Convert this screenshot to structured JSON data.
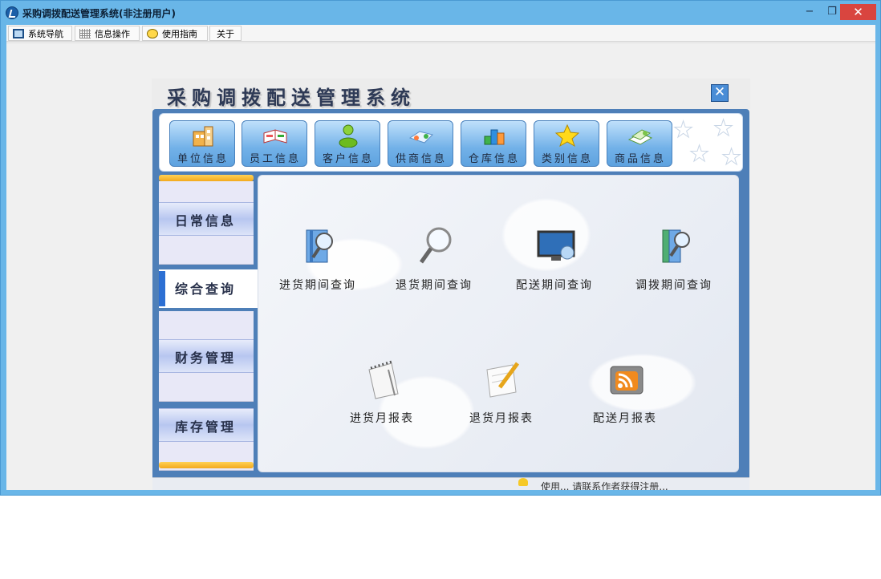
{
  "window": {
    "title": "采购调拨配送管理系统(非注册用户)",
    "controls": [
      "−",
      "❐",
      "✕"
    ]
  },
  "menu": [
    {
      "label": "系统导航",
      "icon": "monitor-icon"
    },
    {
      "label": "信息操作",
      "icon": "grid-icon"
    },
    {
      "label": "使用指南",
      "icon": "smiley-icon"
    },
    {
      "label": "关于",
      "icon": ""
    }
  ],
  "panel": {
    "title": "采购调拨配送管理系统",
    "close_label": "✕"
  },
  "toolbar": [
    {
      "label": "单位信息",
      "icon": "building-icon"
    },
    {
      "label": "员工信息",
      "icon": "book-icon"
    },
    {
      "label": "客户信息",
      "icon": "person-icon"
    },
    {
      "label": "供商信息",
      "icon": "handshake-icon"
    },
    {
      "label": "仓库信息",
      "icon": "warehouse-icon"
    },
    {
      "label": "类别信息",
      "icon": "star-icon"
    },
    {
      "label": "商品信息",
      "icon": "goods-icon"
    }
  ],
  "sidebar": [
    {
      "label": "日常信息",
      "active": false
    },
    {
      "label": "综合查询",
      "active": true
    },
    {
      "label": "财务管理",
      "active": false
    },
    {
      "label": "库存管理",
      "active": false
    }
  ],
  "content": {
    "items": [
      {
        "label": "进货期间查询",
        "icon": "book-search-icon"
      },
      {
        "label": "退货期间查询",
        "icon": "magnifier-icon"
      },
      {
        "label": "配送期间查询",
        "icon": "monitor-search-icon"
      },
      {
        "label": "调拨期间查询",
        "icon": "book-search-icon"
      },
      {
        "label": "进货月报表",
        "icon": "notepad-icon"
      },
      {
        "label": "退货月报表",
        "icon": "pencil-paper-icon"
      },
      {
        "label": "配送月报表",
        "icon": "rss-folder-icon"
      }
    ]
  },
  "status": {
    "text": "使用... 请联系作者获得注册..."
  }
}
